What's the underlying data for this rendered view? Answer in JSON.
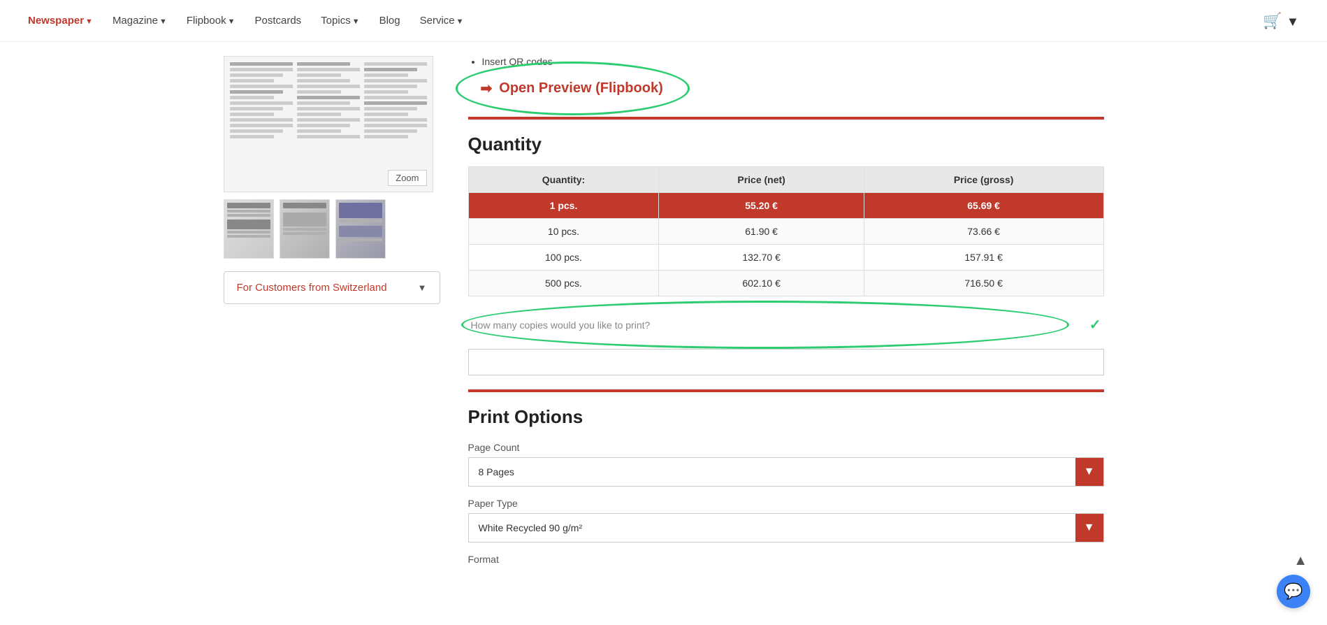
{
  "nav": {
    "newspaper_label": "Newspaper",
    "magazine_label": "Magazine",
    "flipbook_label": "Flipbook",
    "postcards_label": "Postcards",
    "topics_label": "Topics",
    "blog_label": "Blog",
    "service_label": "Service"
  },
  "left": {
    "zoom_label": "Zoom",
    "swiss_label": "For Customers from Switzerland"
  },
  "preview": {
    "bullet_label": "Insert QR codes",
    "btn_label": "Open Preview (Flipbook)"
  },
  "quantity": {
    "title": "Quantity",
    "col_quantity": "Quantity:",
    "col_price_net": "Price (net)",
    "col_price_gross": "Price (gross)",
    "rows": [
      {
        "qty": "1 pcs.",
        "net": "55.20 €",
        "gross": "65.69 €",
        "selected": true
      },
      {
        "qty": "10 pcs.",
        "net": "61.90 €",
        "gross": "73.66 €",
        "selected": false
      },
      {
        "qty": "100 pcs.",
        "net": "132.70 €",
        "gross": "157.91 €",
        "selected": false
      },
      {
        "qty": "500 pcs.",
        "net": "602.10 €",
        "gross": "716.50 €",
        "selected": false
      }
    ],
    "input_placeholder": "How many copies would you like to print?"
  },
  "print_options": {
    "title": "Print Options",
    "page_count_label": "Page Count",
    "page_count_value": "8 Pages",
    "paper_type_label": "Paper Type",
    "paper_type_value": "White Recycled 90 g/m²",
    "format_label": "Format"
  }
}
